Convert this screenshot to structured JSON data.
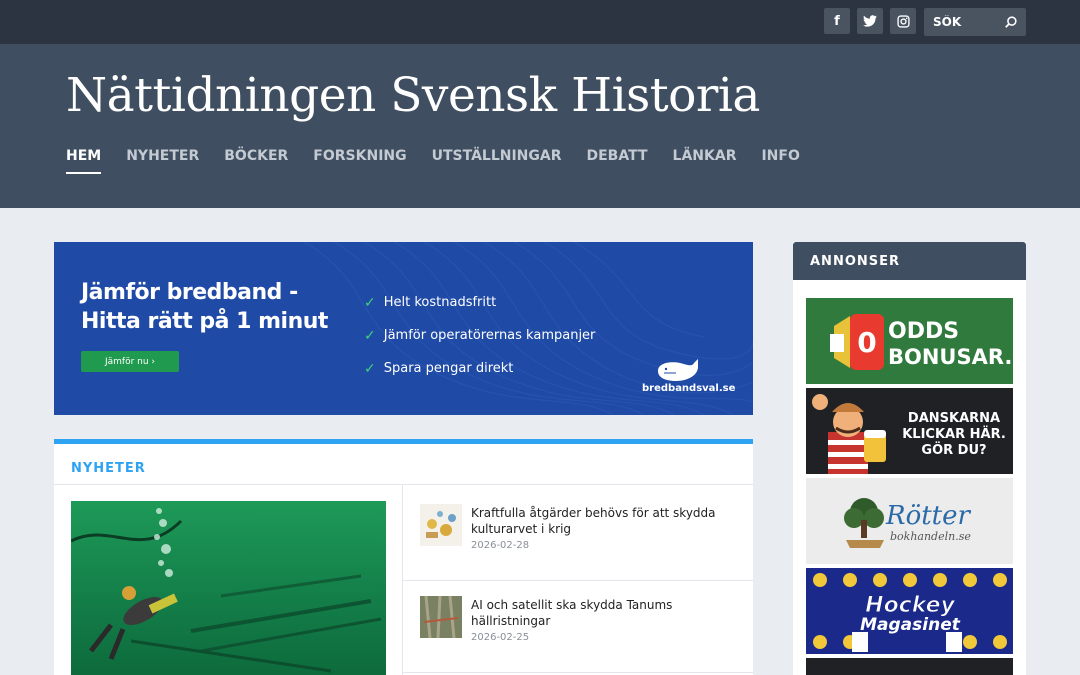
{
  "topbar": {
    "social": [
      {
        "name": "facebook",
        "glyph": "f"
      },
      {
        "name": "twitter",
        "glyph": "t"
      },
      {
        "name": "instagram",
        "glyph": "◘"
      }
    ],
    "search_placeholder": "SÖK"
  },
  "header": {
    "title": "Nättidningen Svensk Historia",
    "nav": [
      {
        "label": "HEM",
        "active": true
      },
      {
        "label": "NYHETER"
      },
      {
        "label": "BÖCKER"
      },
      {
        "label": "FORSKNING"
      },
      {
        "label": "UTSTÄLLNINGAR"
      },
      {
        "label": "DEBATT"
      },
      {
        "label": "LÄNKAR"
      },
      {
        "label": "INFO"
      }
    ]
  },
  "banner": {
    "headline_line1": "Jämför bredband -",
    "headline_line2": "Hitta rätt på 1 minut",
    "cta": "Jämför nu  ›",
    "features": [
      "Helt kostnadsfritt",
      "Jämför operatörernas kampanjer",
      "Spara pengar direkt"
    ],
    "brand": "bredbandsval.se",
    "colors": {
      "background": "#1f4aa5",
      "cta": "#1f9a4e",
      "check": "#3dd37a"
    }
  },
  "news": {
    "heading": "NYHETER",
    "items": [
      {
        "title": "Kraftfulla åtgärder behövs för att skydda kulturarvet i krig",
        "date": "2026-02-28"
      },
      {
        "title": "AI och satellit ska skydda Tanums hällristningar",
        "date": "2026-02-25"
      }
    ]
  },
  "sidebar": {
    "heading": "ANNONSER",
    "ads": [
      {
        "name": "oddsbonusar",
        "line1": "ODDS",
        "line2": "BONUSAR.SE"
      },
      {
        "name": "danskarna",
        "line1": "DANSKARNA",
        "line2": "KLICKAR HÄR.",
        "line3": "GÖR DU?"
      },
      {
        "name": "rotter",
        "line1": "Rötter",
        "line2": "bokhandeln.se"
      },
      {
        "name": "hockey",
        "line1": "Hockey",
        "line2": "Magasinet"
      }
    ]
  },
  "colors": {
    "accent": "#2ea3f2",
    "header": "#3f4e60",
    "topbar": "#2b3440"
  }
}
